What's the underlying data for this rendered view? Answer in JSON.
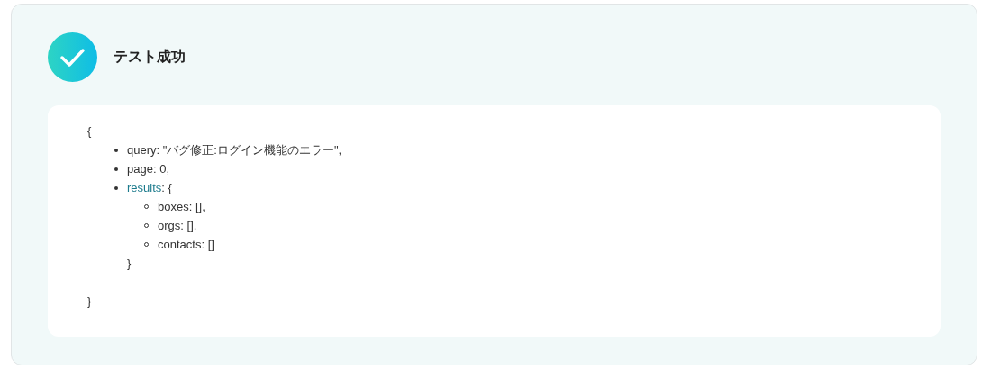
{
  "status": {
    "title": "テスト成功",
    "success": true
  },
  "output": {
    "open": "{",
    "items": [
      {
        "key": "query",
        "link": false,
        "value": ": \"バグ修正:ログイン機能のエラー\","
      },
      {
        "key": "page",
        "link": false,
        "value": ": 0,"
      },
      {
        "key": "results",
        "link": true,
        "value": ": {",
        "children": [
          {
            "key": "boxes",
            "link": false,
            "value": ": [],"
          },
          {
            "key": "orgs",
            "link": false,
            "value": ": [],"
          },
          {
            "key": "contacts",
            "link": false,
            "value": ": []"
          }
        ],
        "close": "}"
      }
    ],
    "close": "}"
  }
}
